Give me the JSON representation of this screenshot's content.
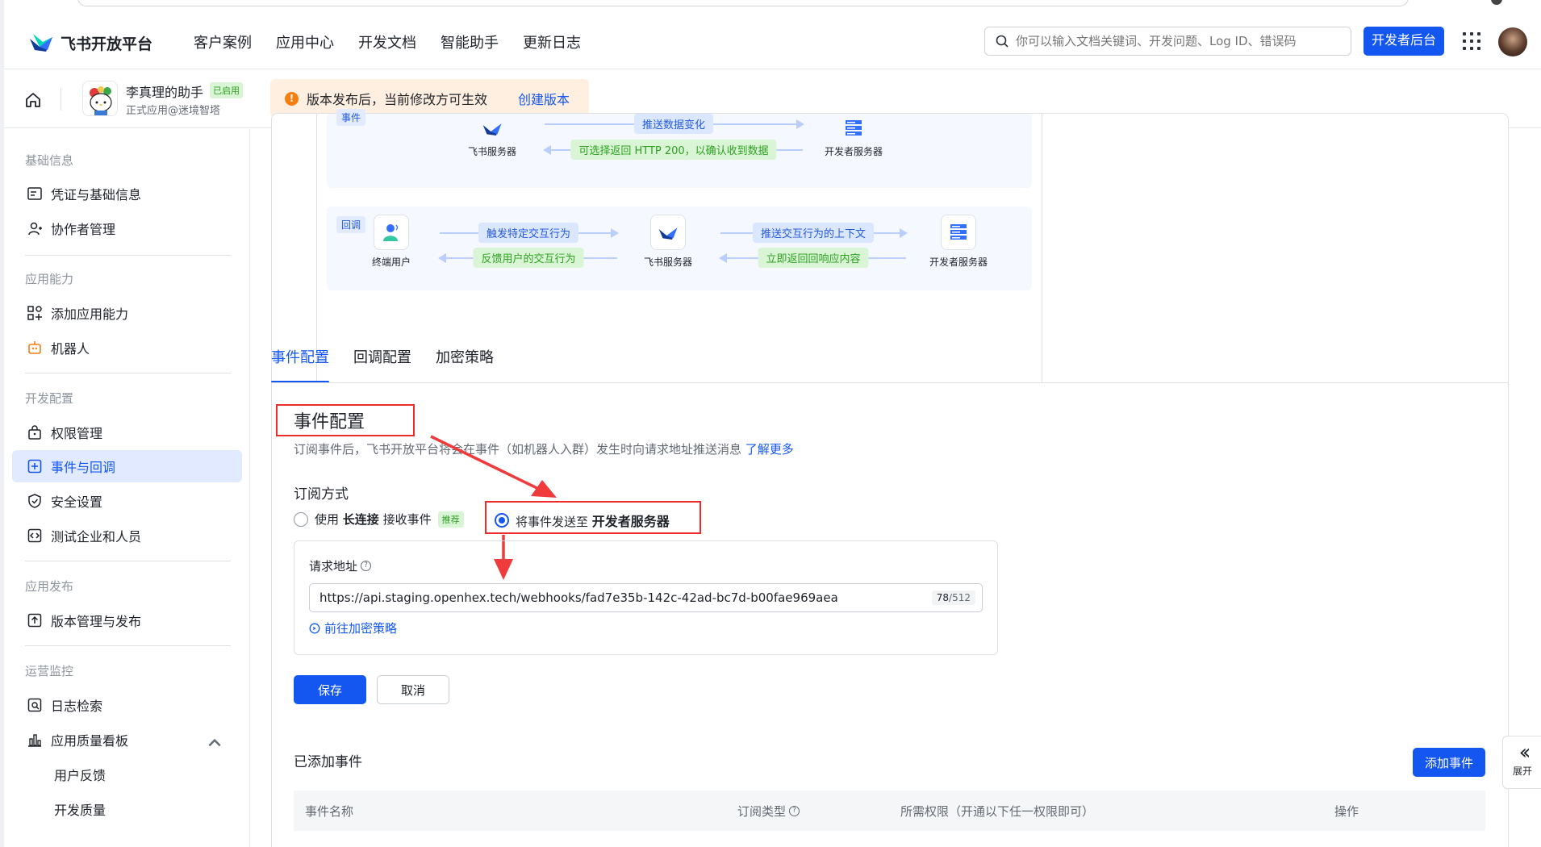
{
  "header": {
    "brand": "飞书开放平台",
    "nav": [
      "客户案例",
      "应用中心",
      "开发文档",
      "智能助手",
      "更新日志"
    ],
    "search_placeholder": "你可以输入文档关键词、开发问题、Log ID、错误码",
    "dev_console": "开发者后台"
  },
  "app": {
    "name": "李真理的助手",
    "status": "已启用",
    "subtitle": "正式应用@迷境智塔",
    "notice": "版本发布后，当前修改方可生效",
    "notice_link": "创建版本"
  },
  "sidebar": {
    "sections": [
      {
        "title": "基础信息",
        "items": [
          "凭证与基础信息",
          "协作者管理"
        ]
      },
      {
        "title": "应用能力",
        "items": [
          "添加应用能力",
          "机器人"
        ]
      },
      {
        "title": "开发配置",
        "items": [
          "权限管理",
          "事件与回调",
          "安全设置",
          "测试企业和人员"
        ]
      },
      {
        "title": "应用发布",
        "items": [
          "版本管理与发布"
        ]
      },
      {
        "title": "运营监控",
        "items": [
          "日志检索",
          "应用质量看板",
          "用户反馈",
          "开发质量"
        ]
      }
    ],
    "active": "事件与回调"
  },
  "diagram": {
    "event_tag": "事件",
    "event_push": "推送数据变化",
    "event_return": "可选择返回 HTTP 200，以确认收到数据",
    "callback_tag": "回调",
    "trigger": "触发特定交互行为",
    "feedback": "反馈用户的交互行为",
    "push_context": "推送交互行为的上下文",
    "return_resp": "立即返回回响应内容",
    "node_feishu": "飞书服务器",
    "node_dev": "开发者服务器",
    "node_user": "终端用户"
  },
  "tabs": [
    "事件配置",
    "回调配置",
    "加密策略"
  ],
  "config": {
    "title": "事件配置",
    "desc": "订阅事件后，飞书开放平台将会在事件（如机器人入群）发生时向请求地址推送消息",
    "learn_more": "了解更多",
    "sub_mode_label": "订阅方式",
    "opt1_pre": "使用",
    "opt1_bold": "长连接",
    "opt1_post": "接收事件",
    "opt1_badge": "推荐",
    "opt2_pre": "将事件发送至",
    "opt2_bold": "开发者服务器",
    "url_label": "请求地址",
    "url_value": "https://api.staging.openhex.tech/webhooks/fad7e35b-142c-42ad-bc7d-b00fae969aea",
    "url_count": "78",
    "url_max": "/512",
    "enc_link": "前往加密策略",
    "save": "保存",
    "cancel": "取消"
  },
  "events": {
    "title": "已添加事件",
    "add": "添加事件",
    "columns": [
      "事件名称",
      "订阅类型",
      "所需权限（开通以下任一权限即可）",
      "操作"
    ]
  },
  "expand": "展开",
  "colors": {
    "primary": "#1456f0",
    "annotation_red": "#ef2b2b",
    "warning": "#f77d11"
  }
}
